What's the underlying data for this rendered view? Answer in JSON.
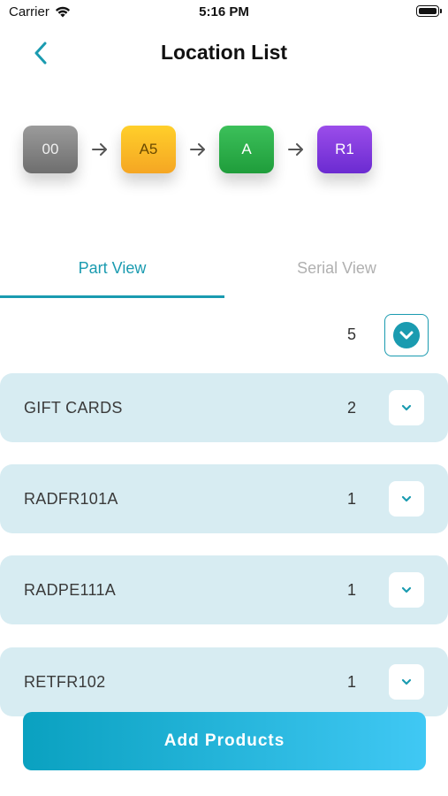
{
  "status_bar": {
    "carrier": "Carrier",
    "time": "5:16 PM"
  },
  "nav": {
    "title": "Location List"
  },
  "path": [
    {
      "label": "00",
      "color": "#8a8a8a"
    },
    {
      "label": "A5",
      "color": "#f8bc24"
    },
    {
      "label": "A",
      "color": "#2db14b"
    },
    {
      "label": "R1",
      "color": "#8a3be0"
    }
  ],
  "tabs": {
    "part_view": "Part View",
    "serial_view": "Serial View",
    "active": "Part View"
  },
  "summary": {
    "total_count": "5"
  },
  "parts": [
    {
      "name": "GIFT CARDS",
      "quantity": "2"
    },
    {
      "name": "RADFR101A",
      "quantity": "1"
    },
    {
      "name": "RADPE111A",
      "quantity": "1"
    },
    {
      "name": "RETFR102",
      "quantity": "1"
    }
  ],
  "actions": {
    "add_products": "Add Products"
  },
  "colors": {
    "accent": "#1a9bb0",
    "card_bg": "#d7ecf2"
  }
}
